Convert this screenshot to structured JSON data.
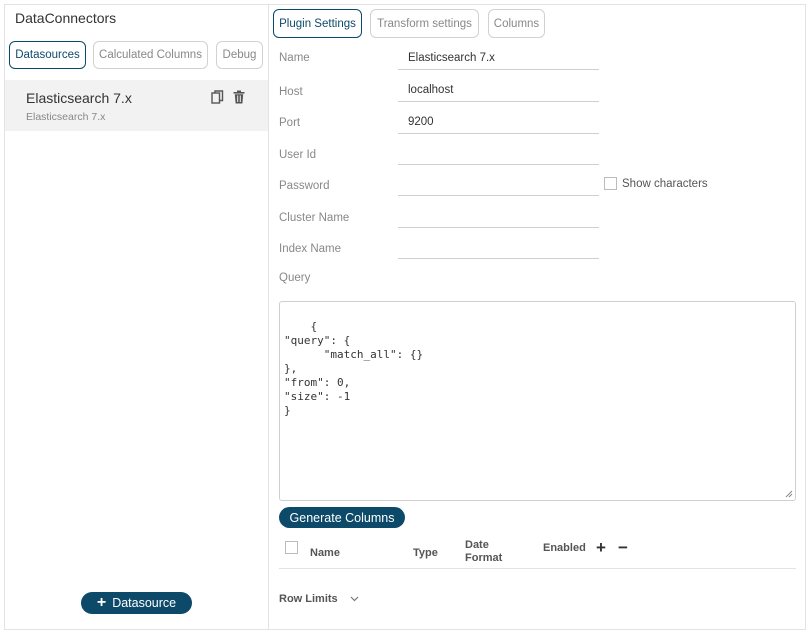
{
  "app": {
    "title": "DataConnectors"
  },
  "left_tabs": [
    {
      "label": "Datasources",
      "active": true
    },
    {
      "label": "Calculated Columns",
      "active": false
    },
    {
      "label": "Debug",
      "active": false
    }
  ],
  "datasource": {
    "name": "Elasticsearch 7.x",
    "type": "Elasticsearch 7.x",
    "copy_icon": "copy-icon",
    "delete_icon": "trash-icon"
  },
  "add_datasource": {
    "label": "Datasource",
    "icon": "plus-icon"
  },
  "right_tabs": [
    {
      "label": "Plugin Settings",
      "active": true
    },
    {
      "label": "Transform settings",
      "active": false
    },
    {
      "label": "Columns",
      "active": false
    }
  ],
  "fields": {
    "name": {
      "label": "Name",
      "value": "Elasticsearch 7.x"
    },
    "host": {
      "label": "Host",
      "value": "localhost"
    },
    "port": {
      "label": "Port",
      "value": "9200"
    },
    "user_id": {
      "label": "User Id",
      "value": ""
    },
    "password": {
      "label": "Password",
      "value": ""
    },
    "cluster_name": {
      "label": "Cluster Name",
      "value": ""
    },
    "index_name": {
      "label": "Index Name",
      "value": ""
    },
    "query": {
      "label": "Query",
      "value": "{\n\"query\": {\n      \"match_all\": {}\n},\n\"from\": 0,\n\"size\": -1\n}"
    }
  },
  "show_characters": {
    "label": "Show characters",
    "checked": false
  },
  "generate_columns": {
    "label": "Generate Columns"
  },
  "columns_table": {
    "headers": [
      "Name",
      "Type",
      "Date Format",
      "Enabled"
    ],
    "date_format_line1": "Date",
    "date_format_line2": "Format",
    "add_symbol": "+",
    "remove_symbol": "−"
  },
  "row_limits": {
    "label": "Row Limits",
    "icon": "chevron-down-icon"
  },
  "colors": {
    "accent": "#0d4a6a",
    "selected_bg": "#f2f2f2",
    "border": "#d2d2d2"
  }
}
